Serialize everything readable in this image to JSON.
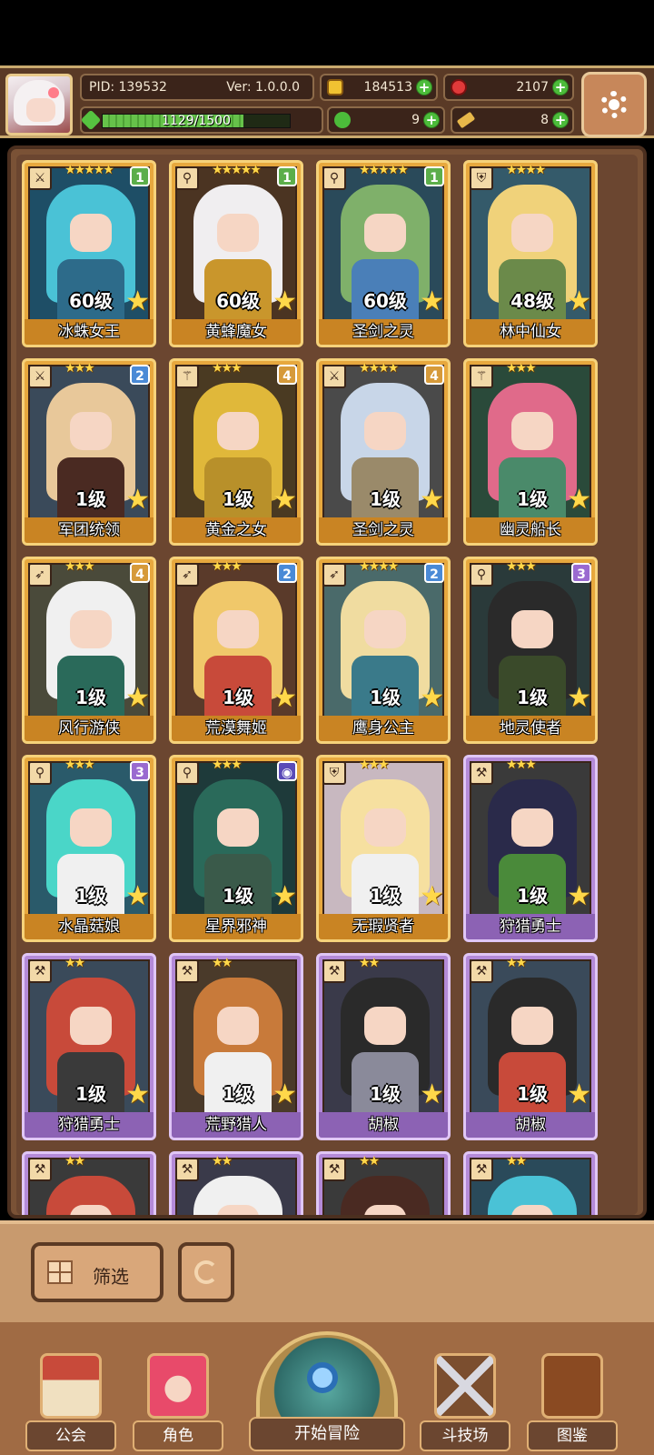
{
  "player": {
    "pid": "PID: 139532",
    "version": "Ver: 1.0.0.0",
    "gold": "184513",
    "gems": "2107",
    "exp_text": "1129/1500",
    "exp_progress": 0.753,
    "clover": "9",
    "keys": "8"
  },
  "colors": {
    "gold_frame": "#e7a83e",
    "purple_frame": "#b48ad8",
    "plus_green": "#4cbc3a",
    "panel_brown": "#7a5236"
  },
  "cards": [
    {
      "name": "冰蛛女王",
      "level": "60级",
      "stars": "★★★★★",
      "badge": "1",
      "badge_color": "#5cae4a",
      "class_icon": "sword-icon",
      "frame": "gold",
      "hair": "#4ac2d6",
      "body": "#2d6b8a",
      "bg": "#1e4e66"
    },
    {
      "name": "黄蜂魔女",
      "level": "60级",
      "stars": "★★★★★",
      "badge": "1",
      "badge_color": "#5cae4a",
      "class_icon": "wand-icon",
      "frame": "gold",
      "hair": "#f0eef0",
      "body": "#c9962c",
      "bg": "#4b3422"
    },
    {
      "name": "圣剑之灵",
      "level": "60级",
      "stars": "★★★★★",
      "badge": "1",
      "badge_color": "#5cae4a",
      "class_icon": "wand-icon",
      "frame": "gold",
      "hair": "#7fb06a",
      "body": "#4a7fb8",
      "bg": "#2a4a5a"
    },
    {
      "name": "林中仙女",
      "level": "48级",
      "stars": "★★★★",
      "badge": "",
      "badge_color": "",
      "class_icon": "shield-icon",
      "frame": "gold",
      "hair": "#f0d27a",
      "body": "#6b8a4a",
      "bg": "#345a6a"
    },
    {
      "name": "军团统领",
      "level": "1级",
      "stars": "★★★",
      "badge": "2",
      "badge_color": "#4a8ad6",
      "class_icon": "sword-icon",
      "frame": "gold",
      "hair": "#e8c89a",
      "body": "#4a2a22",
      "bg": "#3a4a5a"
    },
    {
      "name": "黄金之女",
      "level": "1级",
      "stars": "★★★",
      "badge": "4",
      "badge_color": "#d69a3a",
      "class_icon": "staff-icon",
      "frame": "gold",
      "hair": "#e0b83a",
      "body": "#b8902a",
      "bg": "#4a3a22"
    },
    {
      "name": "圣剑之灵",
      "level": "1级",
      "stars": "★★★★",
      "badge": "4",
      "badge_color": "#d69a3a",
      "class_icon": "sword-icon",
      "frame": "gold",
      "hair": "#c8d6e8",
      "body": "#9a8a6a",
      "bg": "#4a4a4a"
    },
    {
      "name": "幽灵船长",
      "level": "1级",
      "stars": "★★★",
      "badge": "",
      "badge_color": "",
      "class_icon": "staff-icon",
      "frame": "gold",
      "hair": "#e06a8a",
      "body": "#4a8a6a",
      "bg": "#2a4a3a"
    },
    {
      "name": "风行游侠",
      "level": "1级",
      "stars": "★★★",
      "badge": "4",
      "badge_color": "#d69a3a",
      "class_icon": "bow-icon",
      "frame": "gold",
      "hair": "#f0f0f0",
      "body": "#2a6a5a",
      "bg": "#4a4a3a"
    },
    {
      "name": "荒漠舞姬",
      "level": "1级",
      "stars": "★★★",
      "badge": "2",
      "badge_color": "#4a8ad6",
      "class_icon": "bow-icon",
      "frame": "gold",
      "hair": "#f0c86a",
      "body": "#c84a3a",
      "bg": "#5a3a2a"
    },
    {
      "name": "鹰身公主",
      "level": "1级",
      "stars": "★★★★",
      "badge": "2",
      "badge_color": "#4a8ad6",
      "class_icon": "bow-icon",
      "frame": "gold",
      "hair": "#f0dca0",
      "body": "#3a7a8a",
      "bg": "#4a6a6a"
    },
    {
      "name": "地灵使者",
      "level": "1级",
      "stars": "★★★",
      "badge": "3",
      "badge_color": "#9a6ad0",
      "class_icon": "wand-icon",
      "frame": "gold",
      "hair": "#2a2a2a",
      "body": "#3a4a2a",
      "bg": "#2a3a3a"
    },
    {
      "name": "水晶菇娘",
      "level": "1级",
      "stars": "★★★",
      "badge": "3",
      "badge_color": "#9a6ad0",
      "class_icon": "wand-icon",
      "frame": "gold",
      "hair": "#4ad6c8",
      "body": "#f0f0f0",
      "bg": "#2a5a6a"
    },
    {
      "name": "星界邪神",
      "level": "1级",
      "stars": "★★★",
      "badge": "◉",
      "badge_color": "#5a4ab8",
      "class_icon": "wand-icon",
      "frame": "gold",
      "hair": "#2a6a5a",
      "body": "#3a5a4a",
      "bg": "#1e3a3a"
    },
    {
      "name": "无瑕贤者",
      "level": "1级",
      "stars": "★★★",
      "badge": "",
      "badge_color": "",
      "class_icon": "shield-icon",
      "frame": "gold",
      "hair": "#f6e0a0",
      "body": "#f0f0f0",
      "bg": "#c8b8c0"
    },
    {
      "name": "狩猎勇士",
      "level": "1级",
      "stars": "★★★",
      "badge": "",
      "badge_color": "",
      "class_icon": "axe-icon",
      "frame": "purple",
      "hair": "#2a2a4a",
      "body": "#4a8a3a",
      "bg": "#3a3a3a"
    },
    {
      "name": "狩猎勇士",
      "level": "1级",
      "stars": "★★",
      "badge": "",
      "badge_color": "",
      "class_icon": "axe-icon",
      "frame": "purple",
      "hair": "#c84a3a",
      "body": "#3a3a3a",
      "bg": "#3a4a5a"
    },
    {
      "name": "荒野猎人",
      "level": "1级",
      "stars": "★★",
      "badge": "",
      "badge_color": "",
      "class_icon": "axe-icon",
      "frame": "purple",
      "hair": "#c87a3a",
      "body": "#f0f0f0",
      "bg": "#4a3a2a"
    },
    {
      "name": "胡椒",
      "level": "1级",
      "stars": "★★",
      "badge": "",
      "badge_color": "",
      "class_icon": "axe-icon",
      "frame": "purple",
      "hair": "#2a2a2a",
      "body": "#8a8a9a",
      "bg": "#3a3a4a"
    },
    {
      "name": "胡椒",
      "level": "1级",
      "stars": "★★",
      "badge": "",
      "badge_color": "",
      "class_icon": "axe-icon",
      "frame": "purple",
      "hair": "#2a2a2a",
      "body": "#c84a3a",
      "bg": "#3a4a5a"
    },
    {
      "name": "",
      "level": "",
      "stars": "★★",
      "badge": "",
      "badge_color": "",
      "class_icon": "axe-icon",
      "frame": "purple",
      "hair": "#c84a3a",
      "body": "#c84a3a",
      "bg": "#3a3a3a"
    },
    {
      "name": "",
      "level": "",
      "stars": "★★",
      "badge": "",
      "badge_color": "",
      "class_icon": "axe-icon",
      "frame": "purple",
      "hair": "#f0f0f0",
      "body": "#4a8ad6",
      "bg": "#3a3a4a"
    },
    {
      "name": "",
      "level": "",
      "stars": "★★",
      "badge": "",
      "badge_color": "",
      "class_icon": "axe-icon",
      "frame": "purple",
      "hair": "#4a2a22",
      "body": "#4a2a22",
      "bg": "#3a3a3a"
    },
    {
      "name": "",
      "level": "",
      "stars": "★★",
      "badge": "",
      "badge_color": "",
      "class_icon": "axe-icon",
      "frame": "purple",
      "hair": "#4ac2d6",
      "body": "#4ac2d6",
      "bg": "#2a4a5a"
    }
  ],
  "controls": {
    "filter_label": "筛选"
  },
  "nav": {
    "guild": "公会",
    "character": "角色",
    "adventure": "开始冒险",
    "arena": "斗技场",
    "codex": "图鉴"
  }
}
